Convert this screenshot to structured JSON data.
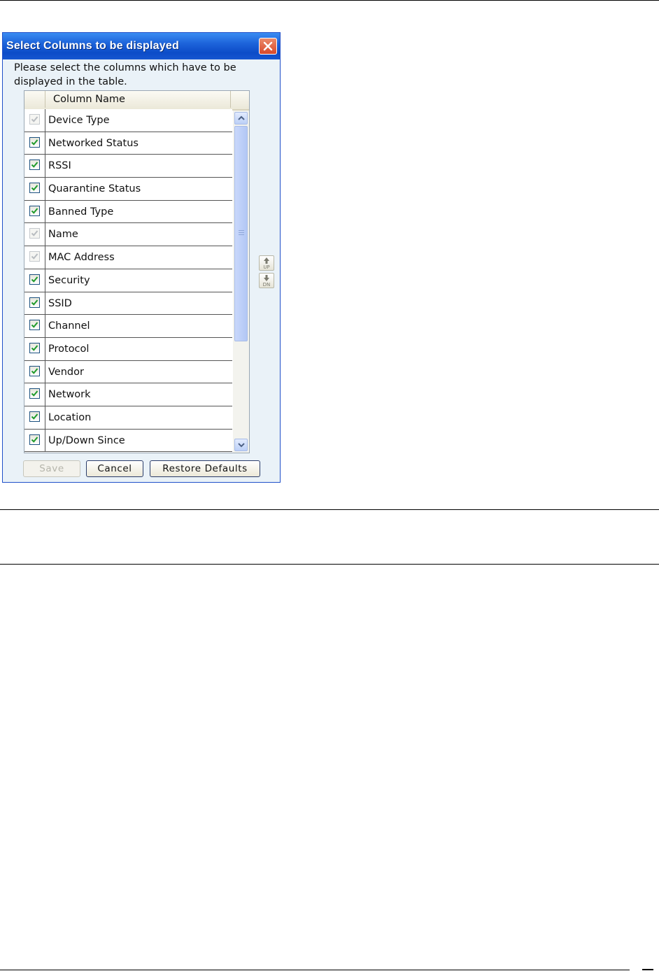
{
  "dialog": {
    "title": "Select Columns to be displayed",
    "instructions": "Please select the columns which have to be displayed in the table.",
    "column_header": "Column Name",
    "rows": [
      {
        "label": "Device Type",
        "checked": true,
        "disabled": true
      },
      {
        "label": "Networked Status",
        "checked": true,
        "disabled": false
      },
      {
        "label": "RSSI",
        "checked": true,
        "disabled": false
      },
      {
        "label": "Quarantine Status",
        "checked": true,
        "disabled": false
      },
      {
        "label": "Banned Type",
        "checked": true,
        "disabled": false
      },
      {
        "label": "Name",
        "checked": true,
        "disabled": true
      },
      {
        "label": "MAC Address",
        "checked": true,
        "disabled": true
      },
      {
        "label": "Security",
        "checked": true,
        "disabled": false
      },
      {
        "label": "SSID",
        "checked": true,
        "disabled": false
      },
      {
        "label": "Channel",
        "checked": true,
        "disabled": false
      },
      {
        "label": "Protocol",
        "checked": true,
        "disabled": false
      },
      {
        "label": "Vendor",
        "checked": true,
        "disabled": false
      },
      {
        "label": "Network",
        "checked": true,
        "disabled": false
      },
      {
        "label": "Location",
        "checked": true,
        "disabled": false
      },
      {
        "label": "Up/Down Since",
        "checked": true,
        "disabled": false
      }
    ],
    "up_label": "UP",
    "down_label": "DN",
    "buttons": {
      "save": "Save",
      "cancel": "Cancel",
      "restore": "Restore Defaults"
    }
  },
  "colors": {
    "title_bar": "#0c4cc8",
    "check": "#1e9a2a",
    "check_disabled": "#b8bcc0",
    "dialog_bg": "#eaf2f8"
  }
}
